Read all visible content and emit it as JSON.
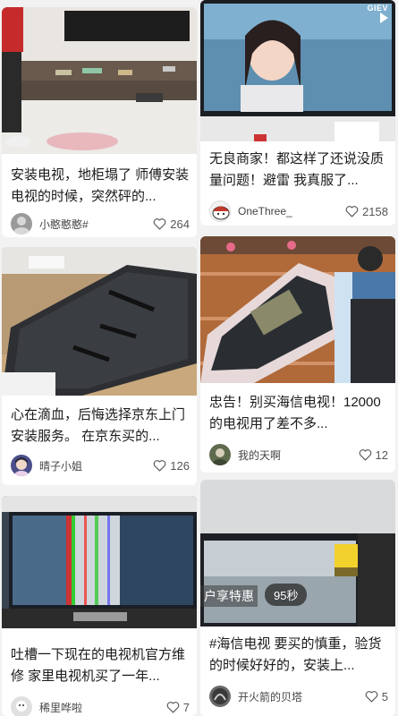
{
  "feed": {
    "cards": [
      {
        "title": "安装电视，地柜塌了 师傅安装电视的时候，突然砰的...",
        "author": "小憨憨憨#",
        "likes": "264",
        "avatar_color": "#9a9a9a"
      },
      {
        "title": "无良商家！都这样了还说没质量问题！避雷 我真服了...",
        "author": "OneThree_",
        "likes": "2158",
        "avatar_color": "#c0392b"
      },
      {
        "title": "心在滴血，后悔选择京东上门安装服务。 在京东买的...",
        "author": "晴子小姐",
        "likes": "126",
        "avatar_color": "#4a4f8a"
      },
      {
        "title": "忠告！别买海信电视！12000的电视用了差不多...",
        "author": "我的天啊",
        "likes": "12",
        "avatar_color": "#5f6b4e"
      },
      {
        "title": "吐槽一下现在的电视机官方维修 家里电视机买了一年...",
        "author": "稀里哗啦",
        "likes": "7",
        "avatar_color": "#b8b8b8"
      },
      {
        "title": "#海信电视 要买的慎重，验货的时候好好的，安装上...",
        "author": "开火箭的贝塔",
        "likes": "5",
        "avatar_color": "#6a6a6a"
      }
    ],
    "overlay_tv_logo": "GIEV",
    "overlay_promo": "户享特惠",
    "overlay_timer": "95秒"
  }
}
